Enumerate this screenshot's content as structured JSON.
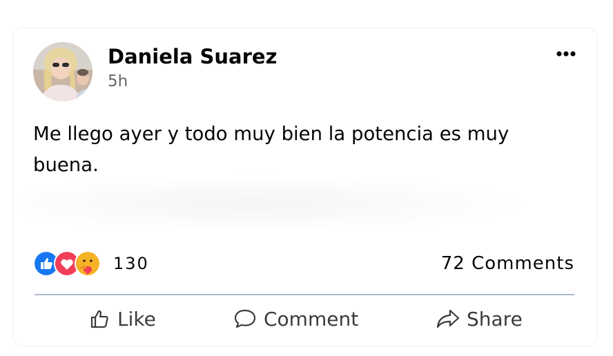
{
  "post": {
    "author": "Daniela Suarez",
    "time": "5h",
    "text": "Me llego ayer y todo muy bien la potencia es muy buena."
  },
  "reactions": {
    "icons": [
      "like-icon",
      "love-icon",
      "care-icon"
    ],
    "count": "130"
  },
  "comments_count": "72 Comments",
  "actions": {
    "like": "Like",
    "comment": "Comment",
    "share": "Share"
  },
  "colors": {
    "like_blue": "#1877f2",
    "love_red": "#f33e58",
    "care_yellow": "#f7b125",
    "divider": "#aeb9c6",
    "secondary_text": "#65676b"
  }
}
